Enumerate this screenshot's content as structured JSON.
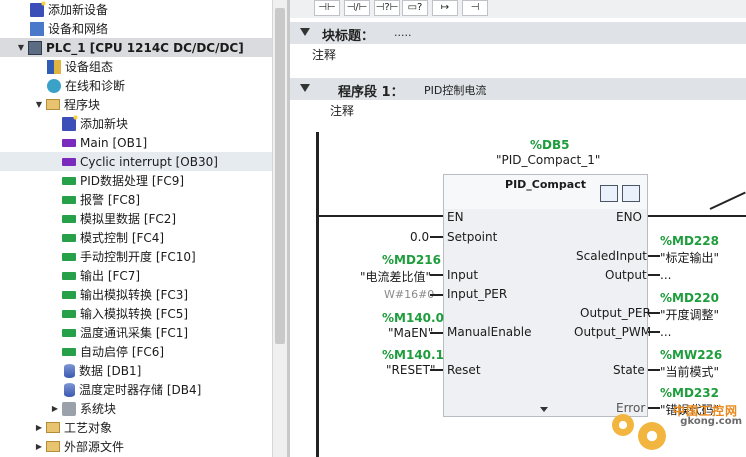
{
  "tree": {
    "items": [
      {
        "label": "添加新设备",
        "icon": "add-device-icon"
      },
      {
        "label": "设备和网络",
        "icon": "network-icon"
      },
      {
        "label": "PLC_1 [CPU 1214C DC/DC/DC]",
        "icon": "plc-icon"
      },
      {
        "label": "设备组态",
        "icon": "device-config-icon"
      },
      {
        "label": "在线和诊断",
        "icon": "diagnostics-icon"
      },
      {
        "label": "程序块",
        "icon": "folder-icon"
      },
      {
        "label": "添加新块",
        "icon": "add-block-icon"
      },
      {
        "label": "Main [OB1]",
        "icon": "ob-block-icon"
      },
      {
        "label": "Cyclic interrupt [OB30]",
        "icon": "ob-block-icon"
      },
      {
        "label": "PID数据处理 [FC9]",
        "icon": "fc-block-icon"
      },
      {
        "label": "报警 [FC8]",
        "icon": "fc-block-icon"
      },
      {
        "label": "模拟里数据 [FC2]",
        "icon": "fc-block-icon"
      },
      {
        "label": "模式控制 [FC4]",
        "icon": "fc-block-icon"
      },
      {
        "label": "手动控制开度 [FC10]",
        "icon": "fc-block-icon"
      },
      {
        "label": "输出 [FC7]",
        "icon": "fc-block-icon"
      },
      {
        "label": "输出模拟转换 [FC3]",
        "icon": "fc-block-icon"
      },
      {
        "label": "输入模拟转换 [FC5]",
        "icon": "fc-block-icon"
      },
      {
        "label": "温度通讯采集 [FC1]",
        "icon": "fc-block-icon"
      },
      {
        "label": "自动启停 [FC6]",
        "icon": "fc-block-icon"
      },
      {
        "label": "数据 [DB1]",
        "icon": "db-block-icon"
      },
      {
        "label": "温度定时器存储 [DB4]",
        "icon": "db-block-icon"
      },
      {
        "label": "系统块",
        "icon": "system-block-icon"
      },
      {
        "label": "工艺对象",
        "icon": "folder-icon"
      },
      {
        "label": "外部源文件",
        "icon": "folder-icon"
      }
    ]
  },
  "toolbar": {
    "buttons": [
      "⊣⊢",
      "⊣/⊢",
      "⊣?⊢",
      "▭?",
      "↦",
      "⊣"
    ]
  },
  "block": {
    "title_label": "块标题：",
    "title_value": ".....",
    "comment": "注释"
  },
  "network": {
    "label": "程序段 1：",
    "name": "PID控制电流",
    "comment": "注释"
  },
  "fb": {
    "instance_db": "%DB5",
    "instance_name": "\"PID_Compact_1\"",
    "type": "PID_Compact",
    "en": "EN",
    "eno": "ENO",
    "inputs": {
      "setpoint": {
        "pin": "Setpoint",
        "value": "0.0"
      },
      "input": {
        "pin": "Input",
        "addr": "%MD216",
        "sym": "\"电流差比值\""
      },
      "input_per": {
        "pin": "Input_PER",
        "value": "W#16#0"
      },
      "manual": {
        "pin": "ManualEnable",
        "addr": "%M140.0",
        "sym": "\"MaEN\""
      },
      "reset": {
        "pin": "Reset",
        "addr": "%M140.1",
        "sym": "\"RESET\""
      }
    },
    "outputs": {
      "scaled": {
        "pin": "ScaledInput",
        "addr": "%MD228",
        "sym": "\"标定输出\""
      },
      "output": {
        "pin": "Output",
        "value": "..."
      },
      "output_per": {
        "pin": "Output_PER",
        "addr": "%MD220",
        "sym": "\"开度调整\""
      },
      "output_pwm": {
        "pin": "Output_PWM",
        "value": "..."
      },
      "state": {
        "pin": "State",
        "addr": "%MW226",
        "sym": "\"当前模式\""
      },
      "error": {
        "pin": "Error",
        "addr": "%MD232",
        "sym": "\"错误代码\""
      }
    }
  },
  "watermark": {
    "brand": "中国工控网",
    "site": "gkong.com"
  }
}
